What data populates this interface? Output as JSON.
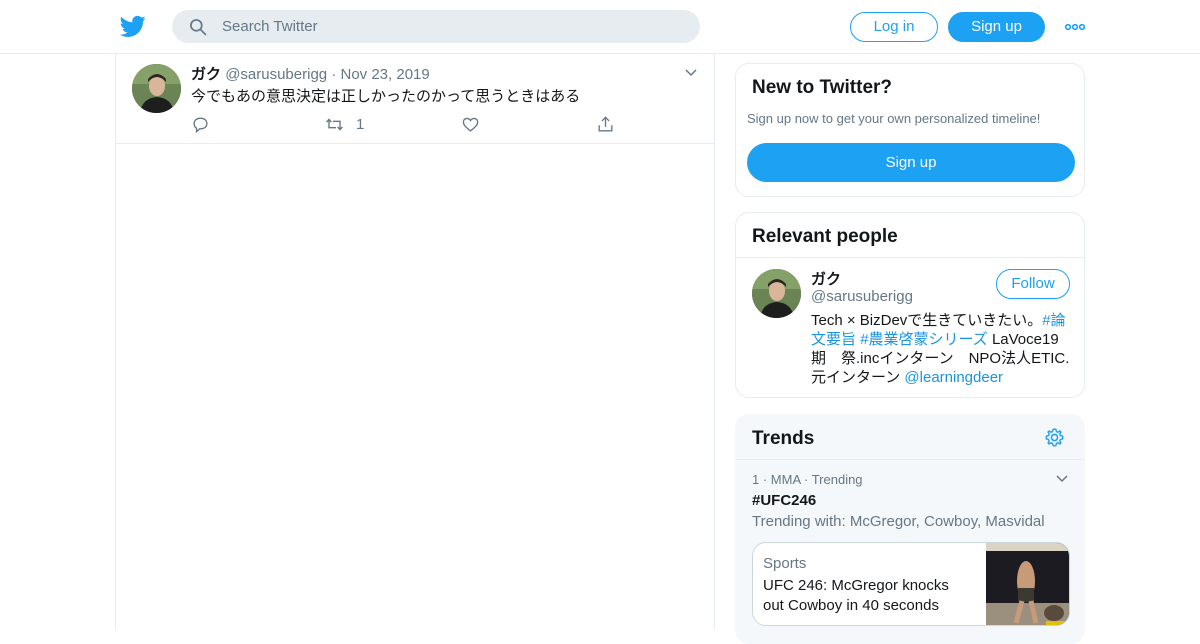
{
  "header": {
    "search_placeholder": "Search Twitter",
    "login_label": "Log in",
    "signup_label": "Sign up"
  },
  "tweet": {
    "name": "ガク",
    "handle": "@sarusuberigg",
    "separator": "·",
    "date": "Nov 23, 2019",
    "text": "今でもあの意思決定は正しかったのかって思うときはある",
    "retweet_count": "1"
  },
  "new_to_twitter": {
    "title": "New to Twitter?",
    "subtitle": "Sign up now to get your own personalized timeline!",
    "signup_label": "Sign up"
  },
  "relevant_people": {
    "title": "Relevant people",
    "name": "ガク",
    "handle": "@sarusuberigg",
    "follow_label": "Follow",
    "bio": {
      "text1": "Tech × BizDevで生きていきたい。",
      "tag1": "#論文要旨",
      "tag2": "#農業啓蒙シリーズ",
      "text2": " LaVoce19期　祭.incインターン　NPO法人ETIC.元インターン ",
      "mention": "@learningdeer"
    }
  },
  "trends": {
    "title": "Trends",
    "item": {
      "meta": "1 · MMA · Trending",
      "name": "#UFC246",
      "with": "Trending with: McGregor, Cowboy, Masvidal"
    },
    "news": {
      "category": "Sports",
      "headline": "UFC 246: McGregor knocks out Cowboy in 40 seconds"
    }
  },
  "colors": {
    "accent": "#1da1f2",
    "secondary_text": "#657786",
    "link": "#1b95e0"
  },
  "icons": [
    "twitter-bird-icon",
    "search-icon",
    "more-icon",
    "chevron-down-icon",
    "reply-icon",
    "retweet-icon",
    "like-icon",
    "share-icon",
    "gear-icon"
  ]
}
